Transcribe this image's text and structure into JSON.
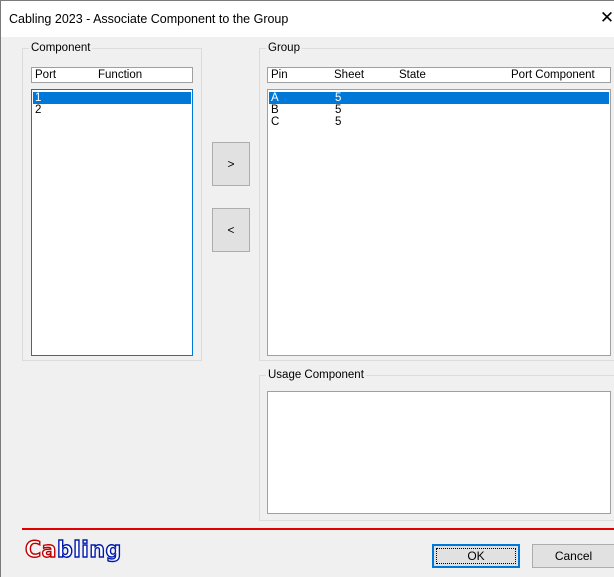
{
  "window": {
    "title": "Cabling 2023 - Associate Component to the Group",
    "close_glyph": "✕"
  },
  "component": {
    "label": "Component",
    "columns": [
      "Port",
      "Function"
    ],
    "rows": [
      {
        "port": "1",
        "function": "",
        "selected": true
      },
      {
        "port": "2",
        "function": "",
        "selected": false
      }
    ]
  },
  "buttons": {
    "add": ">",
    "remove": "<",
    "ok": "OK",
    "cancel": "Cancel"
  },
  "group": {
    "label": "Group",
    "columns": [
      "Pin",
      "Sheet",
      "State",
      "Port Component"
    ],
    "rows": [
      {
        "pin": "A",
        "sheet": "5",
        "state": "",
        "port_component": "",
        "selected": true
      },
      {
        "pin": "B",
        "sheet": "5",
        "state": "",
        "port_component": "",
        "selected": false
      },
      {
        "pin": "C",
        "sheet": "5",
        "state": "",
        "port_component": "",
        "selected": false
      }
    ]
  },
  "usage": {
    "label": "Usage Component"
  },
  "logo": {
    "text_left": "Ca",
    "text_right": "bling",
    "icon": "cabling-logo"
  },
  "colors": {
    "selection": "#0078d7",
    "separator": "#e00000",
    "logo_red": "#c00000",
    "logo_blue": "#0018b0"
  }
}
